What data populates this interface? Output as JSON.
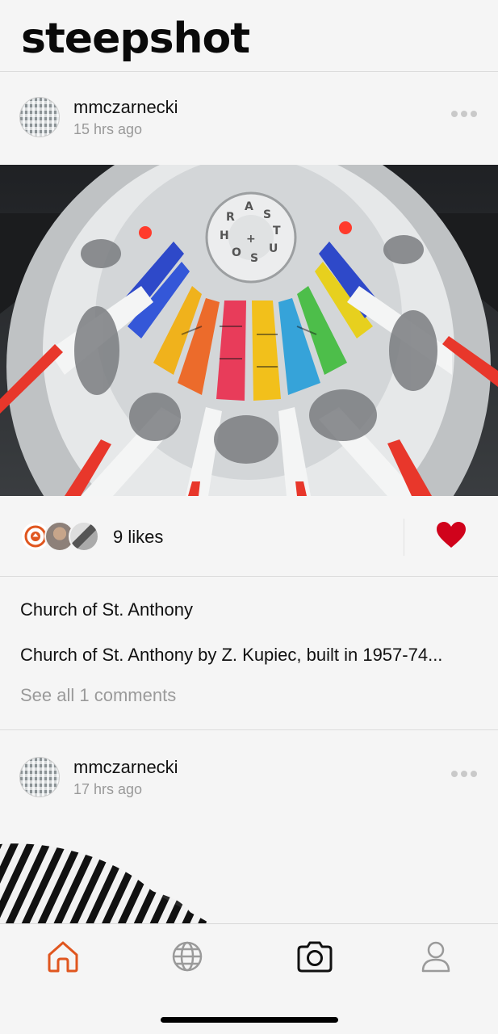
{
  "app": {
    "title": "steepshot"
  },
  "posts": [
    {
      "author": "mmczarnecki",
      "time": "15 hrs ago",
      "likes": "9 likes",
      "title": "Church of St. Anthony",
      "body": "Church of St. Anthony by Z. Kupiec, built in 1957-74...",
      "comments_link": "See all 1 comments",
      "liked": true
    },
    {
      "author": "mmczarnecki",
      "time": "17 hrs ago"
    }
  ],
  "tabs": [
    {
      "name": "home",
      "active": true
    },
    {
      "name": "explore",
      "active": false
    },
    {
      "name": "camera",
      "active": false
    },
    {
      "name": "profile",
      "active": false
    }
  ],
  "colors": {
    "accent": "#e0561f",
    "heart": "#d0021b",
    "muted": "#9a9a9a"
  }
}
